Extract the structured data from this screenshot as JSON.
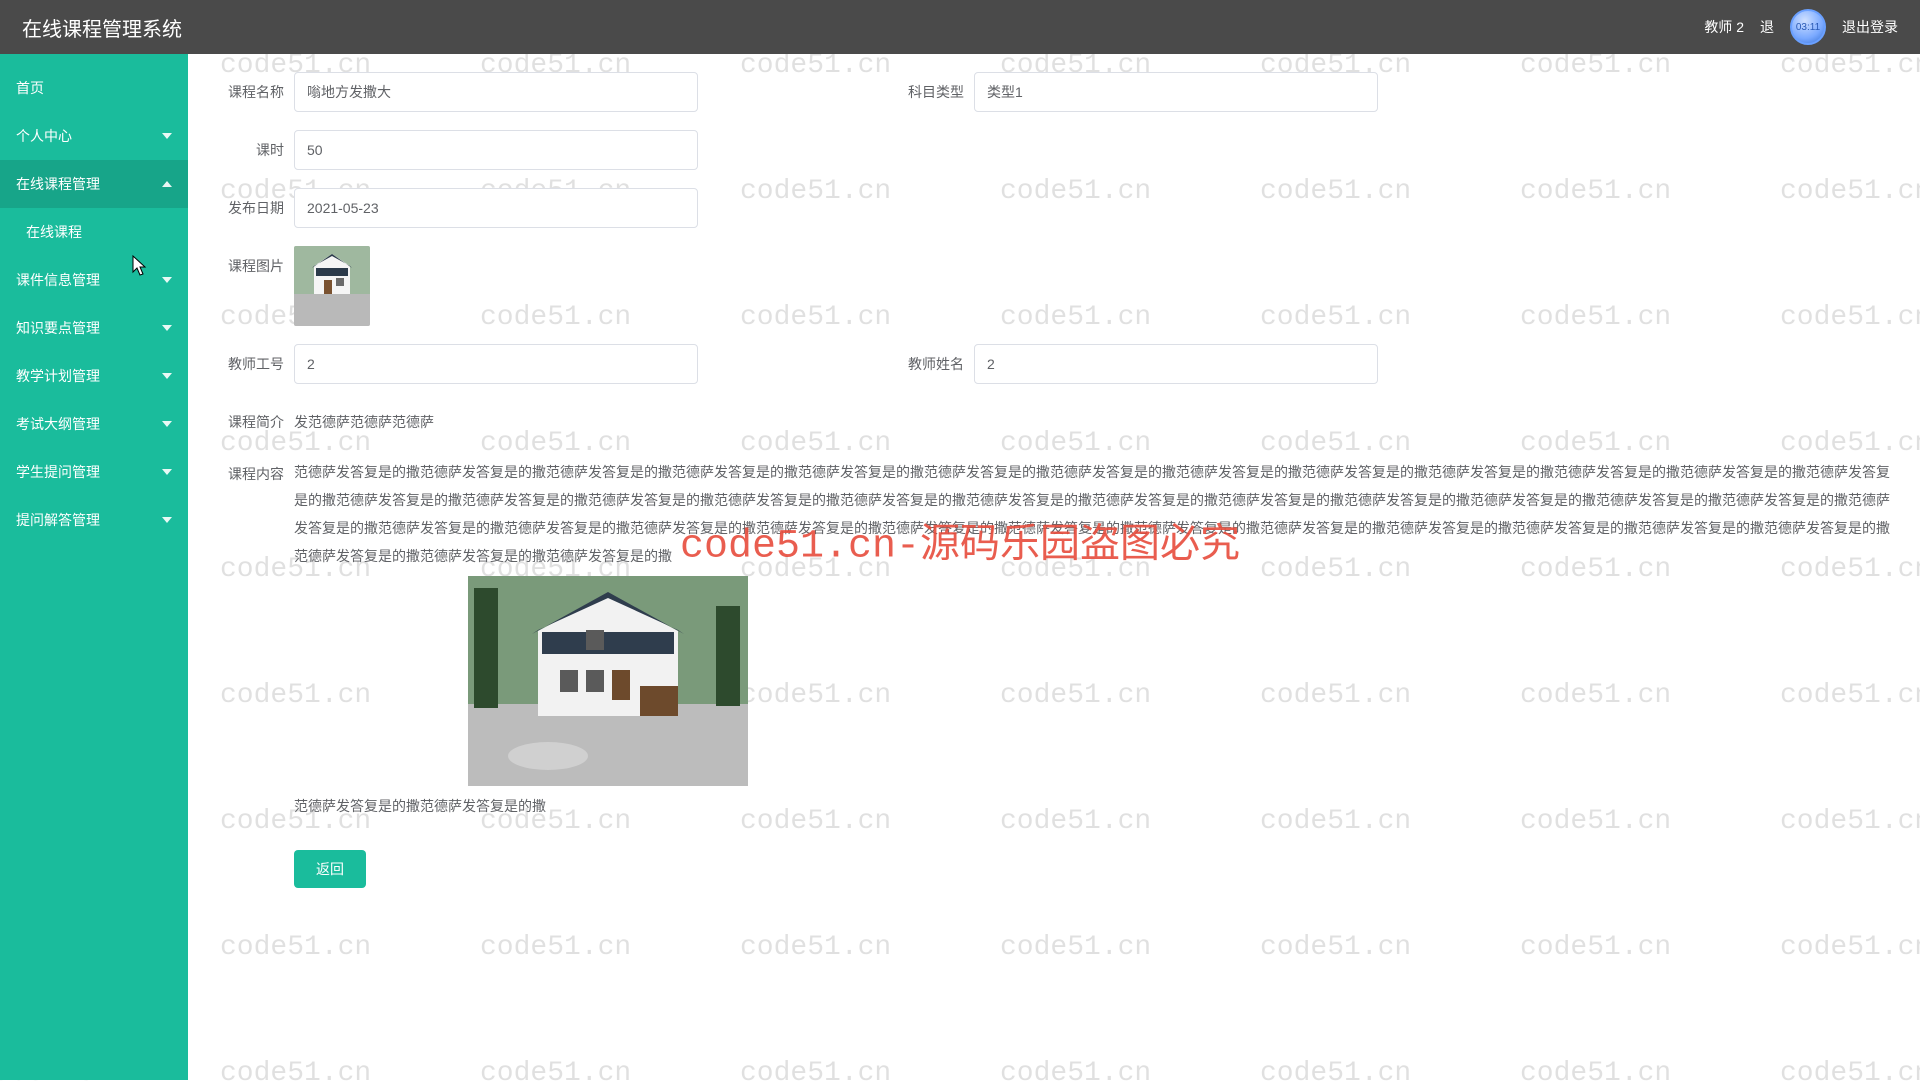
{
  "header": {
    "title": "在线课程管理系统",
    "user": "教师 2",
    "back": "退",
    "avatar_badge": "03:11",
    "logout": "退出登录"
  },
  "sidebar": {
    "home": "首页",
    "personal": "个人中心",
    "course_mgmt": "在线课程管理",
    "course_list": "在线课程",
    "material": "课件信息管理",
    "knowledge": "知识要点管理",
    "plan": "教学计划管理",
    "exam": "考试大纲管理",
    "question": "学生提问管理",
    "answer": "提问解答管理"
  },
  "labels": {
    "course_name": "课程名称",
    "subject_type": "科目类型",
    "hours": "课时",
    "publish_date": "发布日期",
    "course_image": "课程图片",
    "teacher_id": "教师工号",
    "teacher_name": "教师姓名",
    "brief": "课程简介",
    "content": "课程内容",
    "return": "返回"
  },
  "values": {
    "course_name": "嗡地方发撒大",
    "subject_type": "类型1",
    "hours": "50",
    "publish_date": "2021-05-23",
    "teacher_id": "2",
    "teacher_name": "2",
    "brief": "发范德萨范德萨范德萨",
    "content_p1": "范德萨发答复是的撒范德萨发答复是的撒范德萨发答复是的撒范德萨发答复是的撒范德萨发答复是的撒范德萨发答复是的撒范德萨发答复是的撒范德萨发答复是的撒范德萨发答复是的撒范德萨发答复是的撒范德萨发答复是的撒范德萨发答复是的撒范德萨发答复是的撒范德萨发答复是的撒范德萨发答复是的撒范德萨发答复是的撒范德萨发答复是的撒范德萨发答复是的撒范德萨发答复是的撒范德萨发答复是的撒范德萨发答复是的撒范德萨发答复是的撒范德萨发答复是的撒范德萨发答复是的撒范德萨发答复是的撒范德萨发答复是的撒范德萨发答复是的撒范德萨发答复是的撒范德萨发答复是的撒范德萨发答复是的撒范德萨发答复是的撒范德萨发答复是的撒范德萨发答复是的撒范德萨发答复是的撒范德萨发答复是的撒范德萨发答复是的撒范德萨发答复是的撒范德萨发答复是的撒范德萨发答复是的撒范德萨发答复是的撒范德萨发答复是的撒",
    "content_p2": "范德萨发答复是的撒范德萨发答复是的撒"
  },
  "watermark": {
    "text": "code51.cn",
    "center": "code51.cn-源码乐园盗图必究"
  }
}
